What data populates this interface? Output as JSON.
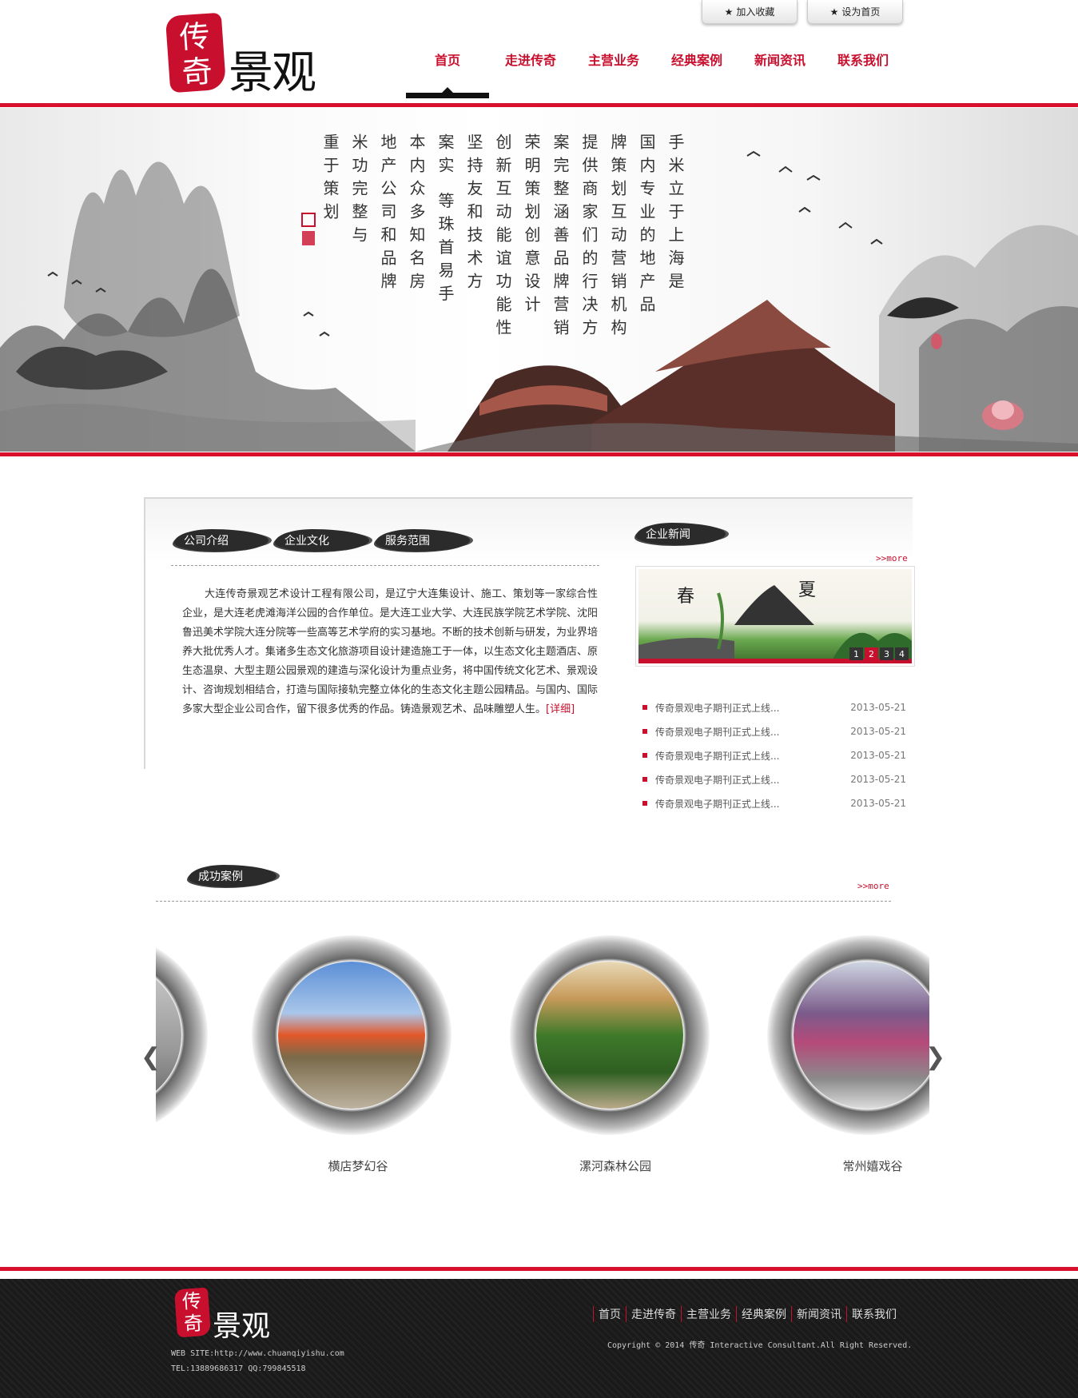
{
  "header": {
    "top_buttons": [
      {
        "label": "加入收藏",
        "icon": "star-icon"
      },
      {
        "label": "设为首页",
        "icon": "star-icon"
      }
    ],
    "logo": {
      "seal_text": "传奇",
      "word": "景观"
    },
    "nav": [
      "首页",
      "走进传奇",
      "主营业务",
      "经典案例",
      "新闻资讯",
      "联系我们"
    ],
    "active_nav": "首页"
  },
  "banner": {
    "poem_columns": [
      "手米立于上海是",
      "国内专业的地产品",
      "牌策划互动营销机构",
      "提供商家们的行决方",
      "案完整涵善品牌营销",
      "荣明策划创意设计",
      "创新互动能谊功能性",
      "坚持友和技术方",
      "案实 等珠首易手",
      "本内众多知名房",
      "地产公司和品牌",
      "米功完整与",
      "重于策划"
    ]
  },
  "about": {
    "tabs": [
      "公司介绍",
      "企业文化",
      "服务范围"
    ],
    "text": "大连传奇景观艺术设计工程有限公司，是辽宁大连集设计、施工、策划等一家综合性企业，是大连老虎滩海洋公园的合作单位。是大连工业大学、大连民族学院艺术学院、沈阳鲁迅美术学院大连分院等一些高等艺术学府的实习基地。不断的技术创新与研发，为业界培养大批优秀人才。集诸多生态文化旅游项目设计建造施工于一体，以生态文化主题酒店、原生态温泉、大型主题公园景观的建造与深化设计为重点业务，将中国传统文化艺术、景观设计、咨询规划相结合，打造与国际接轨完整立体化的生态文化主题公园精品。与国内、国际多家大型企业公司合作，留下很多优秀的作品。铸造景观艺术、品味雕塑人生。",
    "detail_link": "[详细]"
  },
  "news": {
    "title": "企业新闻",
    "more": ">>more",
    "slider": {
      "char1": "春",
      "char2": "夏",
      "pages": [
        "1",
        "2",
        "3",
        "4"
      ],
      "current": "2"
    },
    "items": [
      {
        "title": "传奇景观电子期刊正式上线...",
        "date": "2013-05-21"
      },
      {
        "title": "传奇景观电子期刊正式上线...",
        "date": "2013-05-21"
      },
      {
        "title": "传奇景观电子期刊正式上线...",
        "date": "2013-05-21"
      },
      {
        "title": "传奇景观电子期刊正式上线...",
        "date": "2013-05-21"
      },
      {
        "title": "传奇景观电子期刊正式上线...",
        "date": "2013-05-21"
      }
    ]
  },
  "cases": {
    "title": "成功案例",
    "more": ">>more",
    "prev": "❮",
    "next": "❯",
    "items": [
      {
        "label": "横店梦幻谷"
      },
      {
        "label": "漯河森林公园"
      },
      {
        "label": "常州嬉戏谷"
      }
    ]
  },
  "footer": {
    "logo": {
      "seal_text": "传奇",
      "word": "景观"
    },
    "website": "WEB SITE:http://www.chuanqiyishu.com",
    "contact": "TEL:13889686317 QQ:799845518",
    "nav": [
      "首页",
      "走进传奇",
      "主营业务",
      "经典案例",
      "新闻资讯",
      "联系我们"
    ],
    "copyright": "Copyright © 2014 传奇 Interactive Consultant.All Right Reserved."
  },
  "colors": {
    "accent": "#d8102c",
    "dark": "#1d1d1d"
  }
}
